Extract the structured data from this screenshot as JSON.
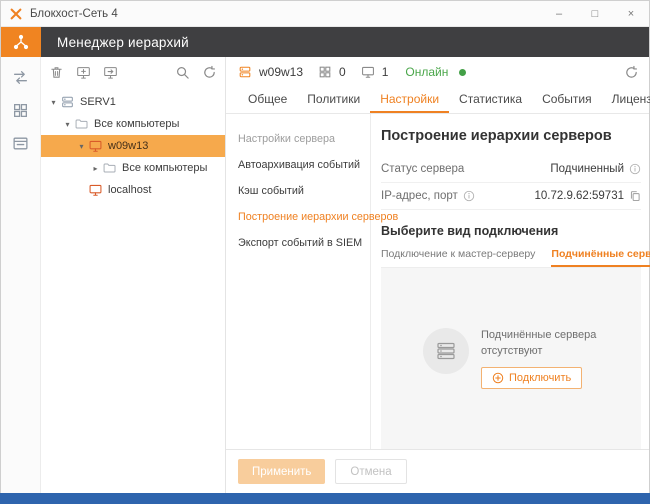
{
  "colors": {
    "accent": "#ef8122",
    "brand_bg": "#f08421",
    "header_bg": "#3f3f41",
    "selected_row_bg": "#f6a94c",
    "online_green": "#43a047",
    "taskbar_blue": "#2e64ad"
  },
  "icons": {
    "expand_open": "▾",
    "expand_closed": "▸",
    "minimize": "–",
    "maximize": "□",
    "close": "×"
  },
  "window": {
    "title": "Блокхост-Сеть 4"
  },
  "header": {
    "title": "Менеджер иерархий"
  },
  "tree": {
    "items": [
      {
        "label": "SERV1"
      },
      {
        "label": "Все компьютеры"
      },
      {
        "label": "w09w13"
      },
      {
        "label": "Все компьютеры"
      },
      {
        "label": "localhost"
      }
    ]
  },
  "server_bar": {
    "name": "w09w13",
    "policies_count": "0",
    "computers_count": "1",
    "status": "Онлайн"
  },
  "tabs": [
    {
      "label": "Общее"
    },
    {
      "label": "Политики"
    },
    {
      "label": "Настройки"
    },
    {
      "label": "Статистика"
    },
    {
      "label": "События"
    },
    {
      "label": "Лицензии"
    }
  ],
  "settings_nav": [
    {
      "label": "Настройки сервера"
    },
    {
      "label": "Автоархивация событий"
    },
    {
      "label": "Кэш событий"
    },
    {
      "label": "Построение иерархии серверов"
    },
    {
      "label": "Экспорт событий в SIEM"
    }
  ],
  "detail": {
    "title": "Построение иерархии серверов",
    "status_label": "Статус сервера",
    "status_value": "Подчиненный",
    "ip_label": "IP-адрес, порт",
    "ip_value": "10.72.9.62:59731",
    "connection_title": "Выберите вид подключения",
    "connection_tabs": [
      {
        "label": "Подключение к мастер-серверу"
      },
      {
        "label": "Подчинённые серверы"
      }
    ],
    "empty_text": "Подчинённые сервера отсутствуют",
    "connect_button": "Подключить"
  },
  "footer": {
    "apply": "Применить",
    "cancel": "Отмена"
  }
}
